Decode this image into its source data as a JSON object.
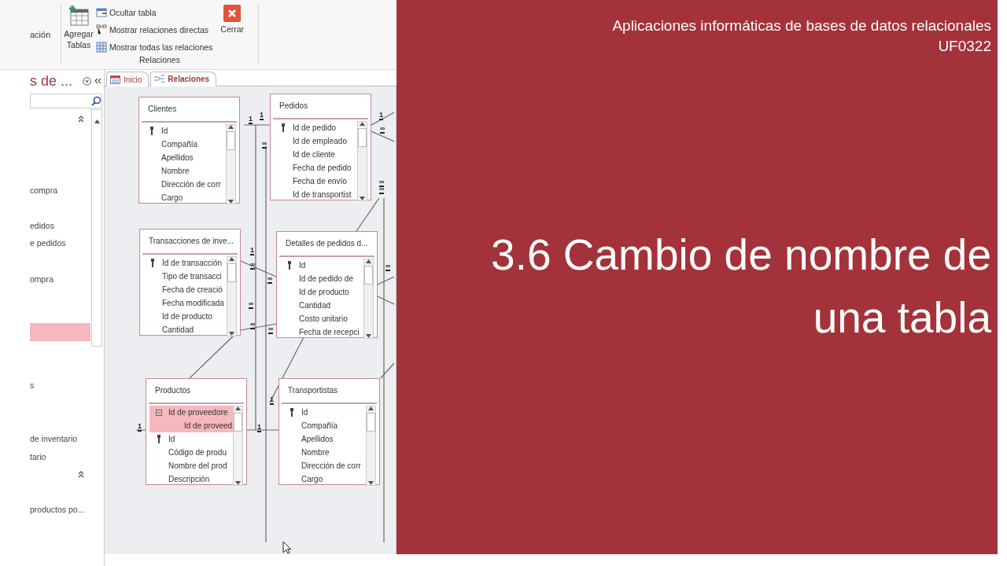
{
  "ribbon": {
    "cut_label": "ación",
    "add_tables": "Agregar Tablas",
    "small_buttons": [
      "Ocultar tabla",
      "Mostrar relaciones directas",
      "Mostrar todas las relaciones"
    ],
    "close": "Cerrar",
    "group_label": "Relaciones"
  },
  "nav_pane": {
    "title": "s de ...",
    "rows": [
      {
        "kind": "header",
        "expanded": true
      },
      {
        "kind": "item",
        "selected": false
      },
      {
        "kind": "item",
        "selected": false
      },
      {
        "kind": "item",
        "selected": false
      },
      {
        "kind": "item",
        "label": "compra",
        "selected": false
      },
      {
        "kind": "item",
        "selected": false
      },
      {
        "kind": "item",
        "label": "edidos",
        "selected": false
      },
      {
        "kind": "item",
        "label": "e pedidos",
        "selected": false
      },
      {
        "kind": "item",
        "selected": false
      },
      {
        "kind": "item",
        "label": "ompra",
        "selected": false
      },
      {
        "kind": "item",
        "selected": false
      },
      {
        "kind": "item",
        "selected": false
      },
      {
        "kind": "item",
        "selected": true
      },
      {
        "kind": "item",
        "selected": false
      },
      {
        "kind": "item",
        "selected": false
      },
      {
        "kind": "item",
        "label": "s",
        "selected": false
      },
      {
        "kind": "item",
        "selected": false
      },
      {
        "kind": "item",
        "selected": false
      },
      {
        "kind": "item",
        "label": "de inventario",
        "selected": false
      },
      {
        "kind": "item",
        "label": "tario",
        "selected": false
      },
      {
        "kind": "header",
        "expanded": true
      },
      {
        "kind": "item",
        "selected": false
      },
      {
        "kind": "item",
        "label": "productos po...",
        "selected": false
      }
    ]
  },
  "doc_tabs": [
    {
      "label": "Inicio",
      "selected": false
    },
    {
      "label": "Relaciones",
      "selected": true
    }
  ],
  "tables": [
    {
      "title": "Clientes",
      "fields": [
        {
          "name": "Id",
          "key": true,
          "selected": false
        },
        {
          "name": "Compañía",
          "key": false,
          "selected": false
        },
        {
          "name": "Apellidos",
          "key": false,
          "selected": false
        },
        {
          "name": "Nombre",
          "key": false,
          "selected": false
        },
        {
          "name": "Dirección de corr",
          "key": false,
          "selected": false
        },
        {
          "name": "Cargo",
          "key": false,
          "selected": false
        }
      ]
    },
    {
      "title": "Pedidos",
      "fields": [
        {
          "name": "Id de pedido",
          "key": true,
          "selected": false
        },
        {
          "name": "Id de empleado",
          "key": false,
          "selected": false
        },
        {
          "name": "Id de cliente",
          "key": false,
          "selected": false
        },
        {
          "name": "Fecha de pedido",
          "key": false,
          "selected": false
        },
        {
          "name": "Fecha de envío",
          "key": false,
          "selected": false
        },
        {
          "name": "Id de transportist",
          "key": false,
          "selected": false
        }
      ]
    },
    {
      "title": "Transacciones de inve...",
      "fields": [
        {
          "name": "Id de transacción",
          "key": true,
          "selected": false
        },
        {
          "name": "Tipo de transacci",
          "key": false,
          "selected": false
        },
        {
          "name": "Fecha de creació",
          "key": false,
          "selected": false
        },
        {
          "name": "Fecha modificada",
          "key": false,
          "selected": false
        },
        {
          "name": "Id de producto",
          "key": false,
          "selected": false
        },
        {
          "name": "Cantidad",
          "key": false,
          "selected": false
        }
      ]
    },
    {
      "title": "Detalles de pedidos d...",
      "fields": [
        {
          "name": "Id",
          "key": true,
          "selected": false
        },
        {
          "name": "Id de pedido de",
          "key": false,
          "selected": false
        },
        {
          "name": "Id de producto",
          "key": false,
          "selected": false
        },
        {
          "name": "Cantidad",
          "key": false,
          "selected": false
        },
        {
          "name": "Costo unitario",
          "key": false,
          "selected": false
        },
        {
          "name": "Fecha de recepci",
          "key": false,
          "selected": false
        }
      ]
    },
    {
      "title": "Productos",
      "fields": [
        {
          "name": "Id de proveedore",
          "key": false,
          "selected": true,
          "expanded": true,
          "children": [
            {
              "name": "Id de proveed",
              "key": false,
              "selected": true
            }
          ]
        },
        {
          "name": "Id",
          "key": true,
          "selected": false
        },
        {
          "name": "Código de produ",
          "key": false,
          "selected": false
        },
        {
          "name": "Nombre del prod",
          "key": false,
          "selected": false
        },
        {
          "name": "Descripción",
          "key": false,
          "selected": false
        }
      ]
    },
    {
      "title": "Transportistas",
      "fields": [
        {
          "name": "Id",
          "key": true,
          "selected": false
        },
        {
          "name": "Compañía",
          "key": false,
          "selected": false
        },
        {
          "name": "Apellidos",
          "key": false,
          "selected": false
        },
        {
          "name": "Nombre",
          "key": false,
          "selected": false
        },
        {
          "name": "Dirección de corr",
          "key": false,
          "selected": false
        },
        {
          "name": "Cargo",
          "key": false,
          "selected": false
        }
      ]
    }
  ],
  "relationship_marks": [
    "1",
    "1",
    "∞",
    "1",
    "∞",
    "∞",
    "∞",
    "1",
    "∞",
    "∞",
    "∞",
    "∞",
    "∞",
    "∞",
    "1",
    "1",
    "1"
  ],
  "slide": {
    "course": "Aplicaciones informáticas de bases de datos relacionales",
    "code": "UF0322",
    "title": "3.6 Cambio de nombre de una tabla"
  }
}
